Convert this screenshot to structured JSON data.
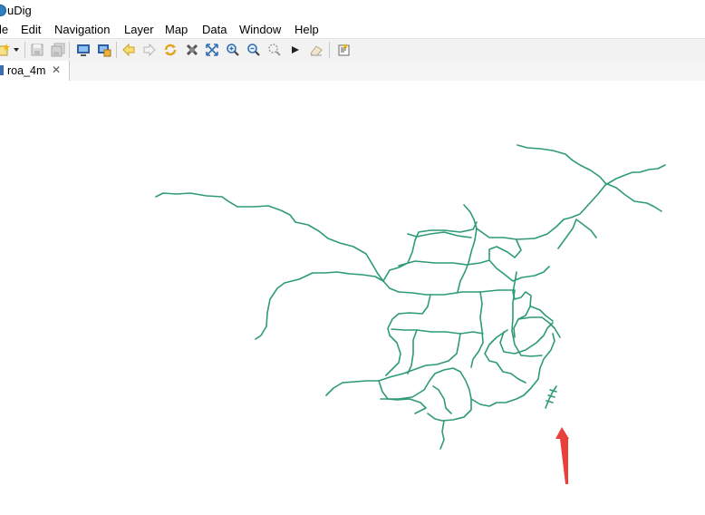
{
  "window": {
    "title": "uDig"
  },
  "menu": [
    "le",
    "Edit",
    "Navigation",
    "Layer",
    "Map",
    "Data",
    "Window",
    "Help"
  ],
  "toolbar": {
    "icons": [
      "new-wizard-icon",
      "dropdown-arrow-icon",
      "save-icon",
      "save-all-icon",
      "show-map-icon",
      "map-properties-icon",
      "back-icon",
      "forward-icon",
      "refresh-icon",
      "stop-icon",
      "zoom-extent-icon",
      "zoom-in-icon",
      "zoom-out-icon",
      "zoom-selection-icon",
      "pan-forward-icon",
      "eraser-icon",
      "edit-note-icon"
    ]
  },
  "editor_tab": {
    "label": "roa_4m",
    "close": "✕"
  },
  "map": {
    "layer": "roa_4m",
    "line_color": "#2e9b74",
    "annotation_arrow_color": "#e8413b"
  }
}
